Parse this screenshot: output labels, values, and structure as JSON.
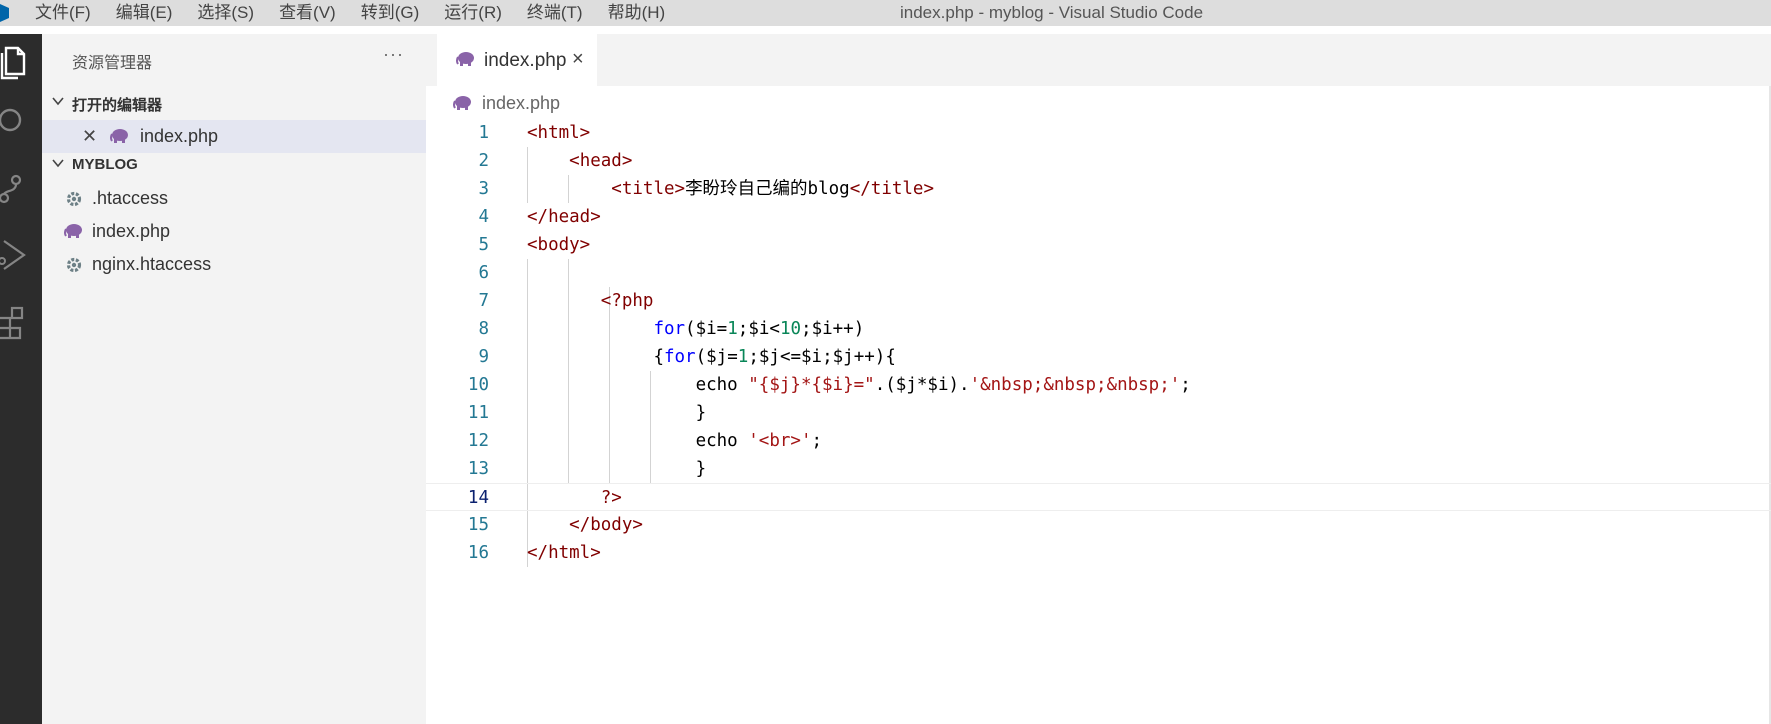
{
  "window": {
    "title": "index.php - myblog - Visual Studio Code",
    "menu": [
      "文件(F)",
      "编辑(E)",
      "选择(S)",
      "查看(V)",
      "转到(G)",
      "运行(R)",
      "终端(T)",
      "帮助(H)"
    ]
  },
  "activity_bar": {
    "items": [
      "explorer-icon",
      "search-icon",
      "source-control-icon",
      "run-debug-icon",
      "extensions-icon"
    ]
  },
  "sidebar": {
    "title": "资源管理器",
    "more": "···",
    "open_editors": {
      "label": "打开的编辑器",
      "items": [
        {
          "name": "index.php",
          "icon": "php-elephant-icon"
        }
      ]
    },
    "folder": {
      "label": "MYBLOG",
      "items": [
        {
          "name": ".htaccess",
          "icon": "gear-icon"
        },
        {
          "name": "index.php",
          "icon": "php-elephant-icon"
        },
        {
          "name": "nginx.htaccess",
          "icon": "gear-icon"
        }
      ]
    }
  },
  "editor": {
    "tab": {
      "label": "index.php",
      "close": "×"
    },
    "breadcrumb": "index.php",
    "current_line": 14,
    "lines": [
      [
        {
          "t": "<html>",
          "c": "tag"
        }
      ],
      [
        {
          "t": "    "
        },
        {
          "t": "<head>",
          "c": "tag"
        }
      ],
      [
        {
          "t": "        "
        },
        {
          "t": "<title>",
          "c": "tag"
        },
        {
          "t": "李盼玲自己编的blog"
        },
        {
          "t": "</title>",
          "c": "tag"
        }
      ],
      [
        {
          "t": "</head>",
          "c": "tag"
        }
      ],
      [
        {
          "t": "<body>",
          "c": "tag"
        }
      ],
      [],
      [
        {
          "t": "       "
        },
        {
          "t": "<?php",
          "c": "tag"
        }
      ],
      [
        {
          "t": "            "
        },
        {
          "t": "for",
          "c": "kw"
        },
        {
          "t": "("
        },
        {
          "t": "$i"
        },
        {
          "t": "="
        },
        {
          "t": "1",
          "c": "num"
        },
        {
          "t": ";"
        },
        {
          "t": "$i"
        },
        {
          "t": "<"
        },
        {
          "t": "10",
          "c": "num"
        },
        {
          "t": ";"
        },
        {
          "t": "$i"
        },
        {
          "t": "++)"
        }
      ],
      [
        {
          "t": "            "
        },
        {
          "t": "{"
        },
        {
          "t": "for",
          "c": "kw"
        },
        {
          "t": "("
        },
        {
          "t": "$j"
        },
        {
          "t": "="
        },
        {
          "t": "1",
          "c": "num"
        },
        {
          "t": ";"
        },
        {
          "t": "$j"
        },
        {
          "t": "<="
        },
        {
          "t": "$i"
        },
        {
          "t": ";"
        },
        {
          "t": "$j"
        },
        {
          "t": "++){"
        }
      ],
      [
        {
          "t": "                "
        },
        {
          "t": "echo "
        },
        {
          "t": "\"{$j}*{$i}=\"",
          "c": "str"
        },
        {
          "t": ".("
        },
        {
          "t": "$j"
        },
        {
          "t": "*"
        },
        {
          "t": "$i"
        },
        {
          "t": ")."
        },
        {
          "t": "'&nbsp;&nbsp;&nbsp;'",
          "c": "str"
        },
        {
          "t": ";"
        }
      ],
      [
        {
          "t": "                "
        },
        {
          "t": "}"
        }
      ],
      [
        {
          "t": "                "
        },
        {
          "t": "echo "
        },
        {
          "t": "'<br>'",
          "c": "str"
        },
        {
          "t": ";"
        }
      ],
      [
        {
          "t": "                "
        },
        {
          "t": "}"
        }
      ],
      [
        {
          "t": "       "
        },
        {
          "t": "?>",
          "c": "tag"
        }
      ],
      [
        {
          "t": "    "
        },
        {
          "t": "</body>",
          "c": "tag"
        }
      ],
      [
        {
          "t": "</html>",
          "c": "tag"
        }
      ]
    ]
  }
}
